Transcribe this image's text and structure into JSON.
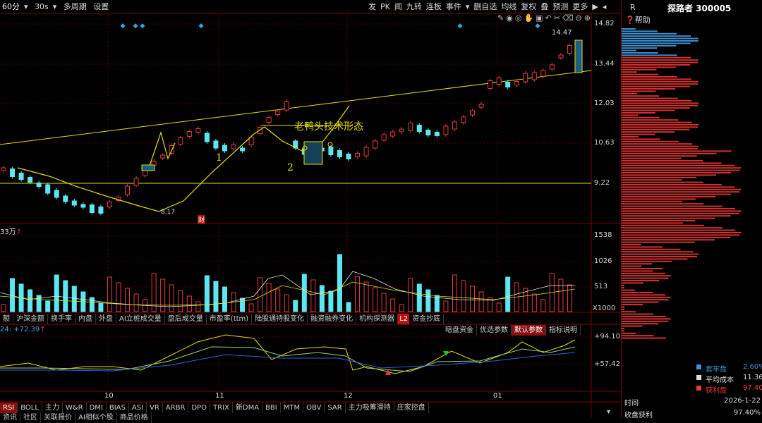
{
  "toolbar": {
    "left": [
      "60分",
      "30s",
      "多周期",
      "设置"
    ],
    "right": [
      "发",
      "PK",
      "闻",
      "九转",
      "连板",
      "事件",
      "删自选",
      "均线",
      "复权",
      "叠",
      "预测",
      "更多"
    ]
  },
  "chart": {
    "prices": [
      "14.82",
      "13.44",
      "12.03",
      "10.63",
      "9.22"
    ],
    "high_label": "14.47",
    "low_label": "8.17",
    "annotation": "老鸭头技术形态",
    "num1": "1",
    "num2": "2",
    "event_mark": "财"
  },
  "volume": {
    "unit_label": "33万",
    "ticks": [
      "1538",
      "1026",
      "513"
    ],
    "scale": "X1000"
  },
  "mid_tabs": [
    "额",
    "沪深金额",
    "换手率",
    "内盘",
    "外盘",
    "AI立桩成交量",
    "盘后成交量",
    "市盈率(ttm)",
    "陆股通持股变化",
    "融资融券变化",
    "机构探测器",
    "L2",
    "资金抄底"
  ],
  "rsi": {
    "header": "24: +72.39",
    "ticks": [
      "+94.10",
      "+57.42"
    ],
    "right_tabs": [
      "暗盘资金",
      "优选参数",
      "默认参数",
      "指标说明"
    ]
  },
  "x_axis": [
    "10",
    "11",
    "12",
    "01"
  ],
  "bottom_tabs": [
    "RSI",
    "BOLL",
    "主力",
    "W&R",
    "DMI",
    "BIAS",
    "ASI",
    "VR",
    "ARBR",
    "DPO",
    "TRIX",
    "新DMA",
    "BBI",
    "MTM",
    "OBV",
    "SAR",
    "主力吸筹滑持",
    "庄家控盘"
  ],
  "bottom_row2": [
    "资讯",
    "社区",
    "关联报价",
    "AI相似个股",
    "商品价格"
  ],
  "right_panel": {
    "r_label": "R",
    "title": "探路者 300005",
    "help": "帮助",
    "legend": [
      {
        "label": "套牢盘",
        "value": "2.60%",
        "color": "#3d8fd1"
      },
      {
        "label": "平均成本",
        "value": "11.36",
        "color": "#dddddd"
      },
      {
        "label": "获利盘",
        "value": "97.40%",
        "color": "#e03c3c"
      }
    ],
    "time_label": "时间",
    "time_value": "2026-1-22",
    "profit_label": "收盘获利",
    "profit_value": "97.40%"
  }
}
